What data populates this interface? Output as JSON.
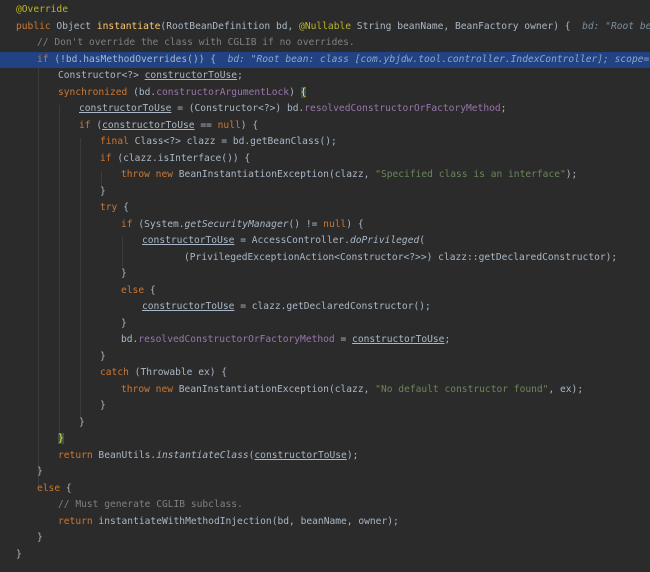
{
  "colors": {
    "background": "#2b2b2b",
    "current_line": "#214283",
    "keyword": "#cc7832",
    "annotation": "#bbb529",
    "comment": "#808080",
    "string": "#6a8759",
    "field": "#9876aa",
    "method_decl": "#ffc66d",
    "default_text": "#a9b7c6",
    "brace_match": "#ffef28"
  },
  "code": {
    "l1": {
      "ann": "@Override"
    },
    "l2": {
      "kw1": "public",
      "t1": " Object ",
      "fn": "instantiate",
      "t2": "(RootBeanDefinition bd, ",
      "ann": "@Nullable",
      "t3": " String beanName, BeanFactory owner) {  ",
      "hint": "bd: \"Root bean: class ["
    },
    "l3": {
      "cm": "// Don't override the class with CGLIB if no overrides."
    },
    "l4": {
      "kw": "if",
      "t1": " (!bd.hasMethodOverrides()) {  ",
      "hint": "bd: \"Root bean: class [com.ybjdw.tool.controller.IndexController]; scope=singleton;"
    },
    "l5": {
      "t1": "Constructor<?> ",
      "var": "constructorToUse",
      "t2": ";"
    },
    "l6": {
      "kw": "synchronized",
      "t1": " (bd.",
      "fld": "constructorArgumentLock",
      "t2": ") ",
      "brace": "{"
    },
    "l7": {
      "var": "constructorToUse",
      "t1": " = (Constructor<?>) bd.",
      "fld": "resolvedConstructorOrFactoryMethod",
      "t2": ";"
    },
    "l8": {
      "kw1": "if",
      "t1": " (",
      "var": "constructorToUse",
      "t2": " == ",
      "kw2": "null",
      "t3": ") {"
    },
    "l9": {
      "kw": "final",
      "t1": " Class<?> clazz = bd.getBeanClass();"
    },
    "l10": {
      "kw": "if",
      "t1": " (clazz.isInterface()) {"
    },
    "l11": {
      "kw1": "throw",
      "t0": " ",
      "kw2": "new",
      "t1": " BeanInstantiationException(clazz, ",
      "str": "\"Specified class is an interface\"",
      "t2": ");"
    },
    "l12": {
      "t1": "}"
    },
    "l13": {
      "kw": "try",
      "t1": " {"
    },
    "l14": {
      "kw1": "if",
      "t1": " (System.",
      "it": "getSecurityManager",
      "t2": "() != ",
      "kw2": "null",
      "t3": ") {"
    },
    "l15": {
      "var": "constructorToUse",
      "t1": " = AccessController.",
      "it": "doPrivileged",
      "t2": "("
    },
    "l16": {
      "t1": "(PrivilegedExceptionAction<Constructor<?>>) clazz::getDeclaredConstructor);"
    },
    "l17": {
      "t1": "}"
    },
    "l18": {
      "kw": "else",
      "t1": " {"
    },
    "l19": {
      "var": "constructorToUse",
      "t1": " = clazz.getDeclaredConstructor();"
    },
    "l20": {
      "t1": "}"
    },
    "l21": {
      "t1": "bd.",
      "fld": "resolvedConstructorOrFactoryMethod",
      "t2": " = ",
      "var": "constructorToUse",
      "t3": ";"
    },
    "l22": {
      "t1": "}"
    },
    "l23": {
      "kw": "catch",
      "t1": " (Throwable ex) {"
    },
    "l24": {
      "kw1": "throw",
      "t0": " ",
      "kw2": "new",
      "t1": " BeanInstantiationException(clazz, ",
      "str": "\"No default constructor found\"",
      "t2": ", ex);"
    },
    "l25": {
      "t1": "}"
    },
    "l26": {
      "t1": "}"
    },
    "l27": {
      "brace": "}"
    },
    "l28": {
      "kw": "return",
      "t1": " BeanUtils.",
      "it": "instantiateClass",
      "t2": "(",
      "var": "constructorToUse",
      "t3": ");"
    },
    "l29": {
      "t1": "}"
    },
    "l30": {
      "kw": "else",
      "t1": " {"
    },
    "l31": {
      "cm": "// Must generate CGLIB subclass."
    },
    "l32": {
      "kw": "return",
      "t1": " instantiateWithMethodInjection(bd, beanName, owner);"
    },
    "l33": {
      "t1": "}"
    },
    "l34": {
      "t1": "}"
    }
  }
}
